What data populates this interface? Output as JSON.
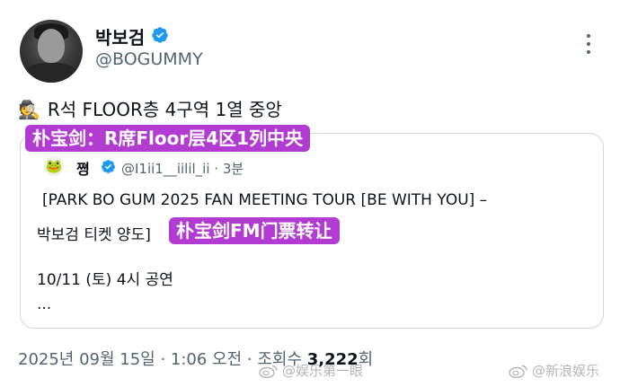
{
  "author": {
    "display_name": "박보검",
    "handle": "@BOGUMMY",
    "verified": true,
    "verified_color": "#1d9bf0"
  },
  "tweet": {
    "text": "R석 FLOOR층 4구역 1열 중앙",
    "emoji_icon": "detective-emoji"
  },
  "captions": {
    "first": "朴宝剑：R席Floor层4区1列中央",
    "second": "朴宝剑FM门票转让",
    "color": "#b23bd1"
  },
  "quoted": {
    "name": "쪙",
    "handle_time": "@I1ii1__iilil_ii · 3분",
    "line1": "[PARK BO GUM 2025 FAN MEETING TOUR [BE WITH YOU] –",
    "line2": "박보검 티켓 양도]",
    "line3": "10/11 (토) 4시 공연",
    "line4": "..."
  },
  "footer": {
    "datetime": "2025년 09월 15일 · 1:06 오전 · 조회수 ",
    "views": "3,222",
    "views_suffix": "회"
  },
  "watermarks": {
    "left": "@娱乐第一眼",
    "right": "@新浪娱乐"
  }
}
